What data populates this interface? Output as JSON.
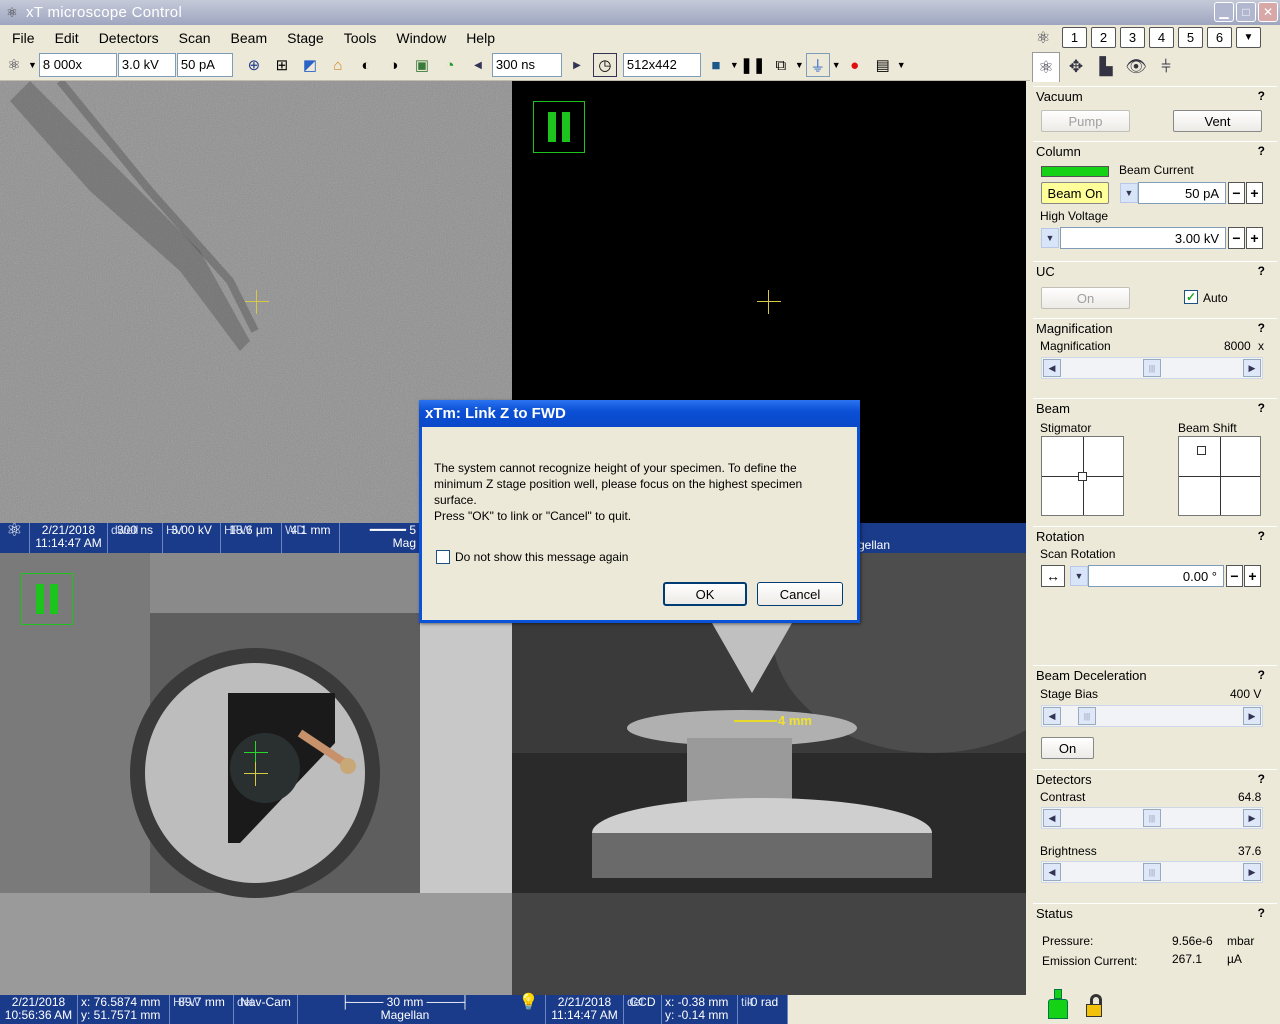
{
  "window": {
    "title": "xT microscope Control"
  },
  "menu": [
    "File",
    "Edit",
    "Detectors",
    "Scan",
    "Beam",
    "Stage",
    "Tools",
    "Window",
    "Help"
  ],
  "toolbar": {
    "magnification": "8 000x",
    "hv": "3.0 kV",
    "current": "50 pA",
    "dwell": "300 ns",
    "resolution": "512x442"
  },
  "quad_buttons": [
    "1",
    "2",
    "3",
    "4",
    "5",
    "6"
  ],
  "databar_top": {
    "date": "2/21/2018",
    "time": "11:14:47 AM",
    "dwell_label": "dwell",
    "dwell": "300 ns",
    "hv_label": "HV",
    "hv": "3.00 kV",
    "hfw_label": "HFW",
    "hfw": "18.6 µm",
    "wd_label": "WD",
    "wd": "4.1 mm",
    "scale": "5",
    "mag_fragment": "Mag",
    "right_fragment": "gellan"
  },
  "databar_navcam": {
    "date": "2/21/2018",
    "time": "10:56:36 AM",
    "x": "x: 76.5874 mm",
    "y": "y: 51.7571 mm",
    "hfw_label": "HFW",
    "hfw": "89.7 mm",
    "det_label": "det",
    "det": "Nav-Cam",
    "scale": "30 mm",
    "system": "Magellan"
  },
  "databar_ccd": {
    "date": "2/21/2018",
    "time": "11:14:47 AM",
    "det_label": "det",
    "det": "CCD",
    "x": "x: -0.38 mm",
    "y": "y: -0.14 mm",
    "tilt_label": "tilt",
    "tilt": "-0 rad"
  },
  "ccd_annotation": "4 mm",
  "dialog": {
    "title": "xTm: Link Z to FWD",
    "message_1": "The system cannot recognize height of your specimen. To define the minimum Z stage position well, please focus on the highest specimen surface.",
    "message_2": "Press \"OK\" to link or \"Cancel\" to quit.",
    "checkbox": "Do not show this message again",
    "ok": "OK",
    "cancel": "Cancel"
  },
  "panel": {
    "vacuum": {
      "title": "Vacuum",
      "pump": "Pump",
      "vent": "Vent"
    },
    "column": {
      "title": "Column",
      "beam_current_label": "Beam Current",
      "beam_on": "Beam On",
      "beam_current": "50 pA",
      "hv_label": "High Voltage",
      "hv": "3.00 kV"
    },
    "uc": {
      "title": "UC",
      "on": "On",
      "auto": "Auto"
    },
    "magnification": {
      "title": "Magnification",
      "label": "Magnification",
      "value": "8000",
      "unit": "x"
    },
    "beam": {
      "title": "Beam",
      "stigmator": "Stigmator",
      "shift": "Beam Shift"
    },
    "rotation": {
      "title": "Rotation",
      "label": "Scan Rotation",
      "value": "0.00 °"
    },
    "decel": {
      "title": "Beam Deceleration",
      "bias_label": "Stage Bias",
      "bias": "400 V",
      "on": "On"
    },
    "detectors": {
      "title": "Detectors",
      "contrast_label": "Contrast",
      "contrast": "64.8",
      "brightness_label": "Brightness",
      "brightness": "37.6"
    },
    "status": {
      "title": "Status",
      "pressure_label": "Pressure:",
      "pressure": "9.56e-6",
      "pressure_unit": "mbar",
      "emission_label": "Emission Current:",
      "emission": "267.1",
      "emission_unit": "µA"
    },
    "help": "?"
  },
  "colors": {
    "accent": "#0a52d8",
    "databar": "#1a3a8a",
    "beam_on": "#ffff99",
    "indicator": "#16d216"
  }
}
